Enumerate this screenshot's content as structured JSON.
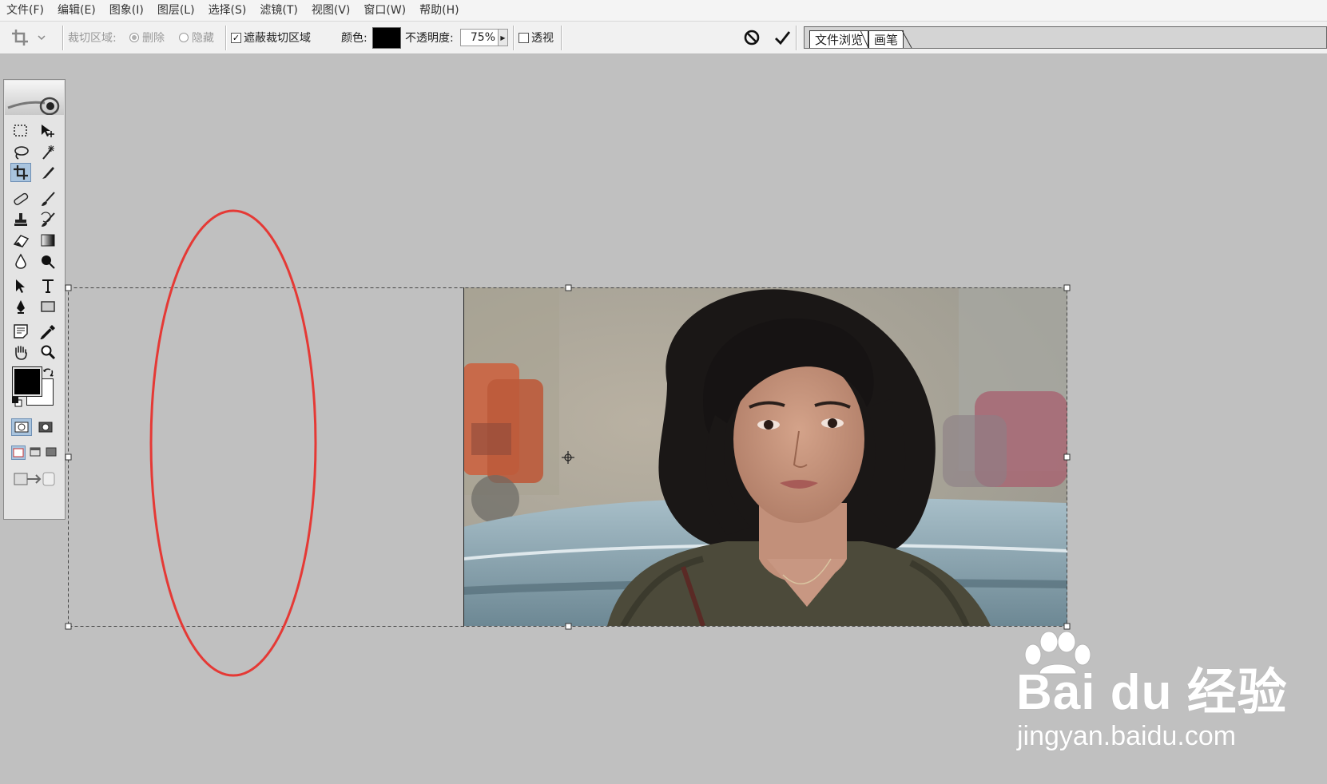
{
  "menu": [
    "文件(F)",
    "编辑(E)",
    "图象(I)",
    "图层(L)",
    "选择(S)",
    "滤镜(T)",
    "视图(V)",
    "窗口(W)",
    "帮助(H)"
  ],
  "options": {
    "crop_area_label": "裁切区域:",
    "delete_label": "删除",
    "hide_label": "隐藏",
    "shield_label": "遮蔽裁切区域",
    "color_label": "颜色:",
    "opacity_label": "不透明度:",
    "opacity_value": "75%",
    "perspective_label": "透视",
    "shield_checked": true,
    "perspective_checked": false,
    "shield_color": "#000000"
  },
  "palette_well": {
    "tabs": [
      "文件浏览",
      "画笔"
    ]
  },
  "annotation": {
    "color": "#e53935",
    "shape": "ellipse"
  },
  "watermark": {
    "text": "Bai du 经验",
    "url": "jingyan.baidu.com"
  },
  "colors": {
    "workspace": "#c0c0c0",
    "active_tool": "#a9c4de"
  },
  "icons": [
    "crop-icon",
    "marquee-icon",
    "move-icon",
    "lasso-icon",
    "magic-wand-icon",
    "slice-icon",
    "healing-icon",
    "brush-icon",
    "stamp-icon",
    "history-brush-icon",
    "eraser-icon",
    "gradient-icon",
    "blur-icon",
    "dodge-icon",
    "path-select-icon",
    "type-icon",
    "pen-icon",
    "shape-icon",
    "notes-icon",
    "eyedropper-icon",
    "hand-icon",
    "zoom-icon",
    "cancel-icon",
    "commit-icon"
  ]
}
